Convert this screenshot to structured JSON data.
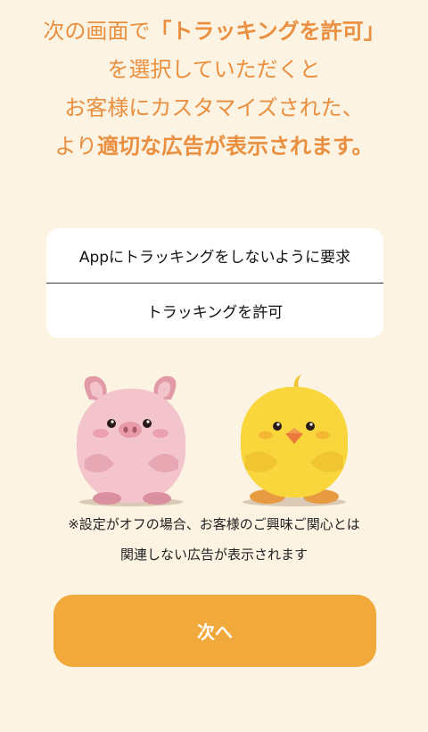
{
  "headline": {
    "line1_a": "次の画面で",
    "line1_b": "「トラッキングを許可」",
    "line2": "を選択していただくと",
    "line3": "お客様にカスタマイズされた、",
    "line4_a": "より",
    "line4_b": "適切な広告が表示されます。"
  },
  "dialog": {
    "ask_not_label": "Appにトラッキングをしないように要求",
    "allow_label": "トラッキングを許可"
  },
  "illustration": {
    "left": "pig-character",
    "right": "chick-character"
  },
  "note": {
    "line1": "※設定がオフの場合、お客様のご興味ご関心とは",
    "line2": "関連しない広告が表示されます"
  },
  "next_button": {
    "label": "次へ"
  },
  "colors": {
    "background": "#fcf3e2",
    "accent_text": "#ea8f3f",
    "button": "#f2a93b"
  }
}
